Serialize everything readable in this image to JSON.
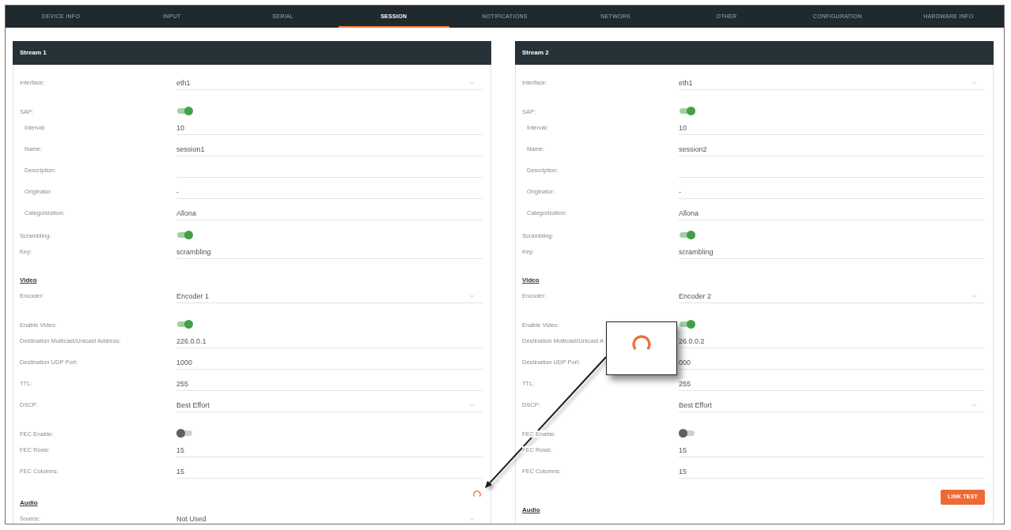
{
  "tabs": [
    {
      "label": "DEVICE INFO",
      "selected": false
    },
    {
      "label": "INPUT",
      "selected": false
    },
    {
      "label": "SERIAL",
      "selected": false
    },
    {
      "label": "SESSION",
      "selected": true
    },
    {
      "label": "NOTIFICATIONS",
      "selected": false
    },
    {
      "label": "NETWORK",
      "selected": false
    },
    {
      "label": "OTHER",
      "selected": false
    },
    {
      "label": "CONFIGURATION",
      "selected": false
    },
    {
      "label": "HARDWARE INFO",
      "selected": false
    }
  ],
  "streams": [
    {
      "title": "Stream 1",
      "fields": [
        {
          "kind": "select",
          "label": "Interface:",
          "value": "eth1"
        },
        {
          "kind": "toggle",
          "label": "SAP:",
          "on": true,
          "children": [
            {
              "kind": "text",
              "label": "Interval:",
              "value": "10"
            },
            {
              "kind": "text",
              "label": "Name:",
              "value": "session1"
            },
            {
              "kind": "text",
              "label": "Description:"
            },
            {
              "kind": "text",
              "label": "Originator:",
              "value": "-"
            },
            {
              "kind": "text",
              "label": "Categorization:",
              "value": "Allona"
            }
          ]
        },
        {
          "kind": "toggle",
          "label": "Scrambling:",
          "on": true
        },
        {
          "kind": "text",
          "label": "Key:",
          "value": "scrambling"
        }
      ],
      "sections": [
        {
          "heading": "Video",
          "fields": [
            {
              "kind": "select",
              "label": "Encoder:",
              "value": "Encoder 1"
            },
            {
              "kind": "toggle",
              "label": "Enable Video:",
              "on": true
            },
            {
              "kind": "text",
              "label": "Destination Multicast/Unicast Address:",
              "value": "226.0.0.1"
            },
            {
              "kind": "text",
              "label": "Destination UDP Port:",
              "value": "1000"
            },
            {
              "kind": "text",
              "label": "TTL:",
              "value": "255"
            },
            {
              "kind": "select",
              "label": "DSCP:",
              "value": "Best Effort"
            },
            {
              "kind": "toggle",
              "label": "FEC Enable:",
              "on": false
            },
            {
              "kind": "text",
              "label": "FEC Rows:",
              "value": "15"
            },
            {
              "kind": "text",
              "label": "FEC Columns:",
              "value": "15"
            }
          ],
          "action": {
            "kind": "spinner"
          }
        },
        {
          "heading": "Audio",
          "fields": [
            {
              "kind": "select",
              "label": "Source:",
              "value": "Not Used"
            }
          ]
        }
      ]
    },
    {
      "title": "Stream 2",
      "fields": [
        {
          "kind": "select",
          "label": "Interface:",
          "value": "eth1"
        },
        {
          "kind": "toggle",
          "label": "SAP:",
          "on": true,
          "children": [
            {
              "kind": "text",
              "label": "Interval:",
              "value": "10"
            },
            {
              "kind": "text",
              "label": "Name:",
              "value": "session2"
            },
            {
              "kind": "text",
              "label": "Description:"
            },
            {
              "kind": "text",
              "label": "Originator:",
              "value": "-"
            },
            {
              "kind": "text",
              "label": "Categorization:",
              "value": "Allona"
            }
          ]
        },
        {
          "kind": "toggle",
          "label": "Scrambling:",
          "on": true
        },
        {
          "kind": "text",
          "label": "Key:",
          "value": "scrambling"
        }
      ],
      "sections": [
        {
          "heading": "Video",
          "fields": [
            {
              "kind": "select",
              "label": "Encoder:",
              "value": "Encoder 2"
            },
            {
              "kind": "toggle",
              "label": "Enable Video:",
              "on": true
            },
            {
              "kind": "text",
              "label": "Destination Multicast/Unicast A",
              "value": "26.0.0.2"
            },
            {
              "kind": "text",
              "label": "Destination UDP Port:",
              "value": "000"
            },
            {
              "kind": "text",
              "label": "TTL:",
              "value": "255"
            },
            {
              "kind": "select",
              "label": "DSCP:",
              "value": "Best Effort"
            },
            {
              "kind": "toggle",
              "label": "FEC Enable:",
              "on": false
            },
            {
              "kind": "text",
              "label": "FEC Rows:",
              "value": "15"
            },
            {
              "kind": "text",
              "label": "FEC Columns:",
              "value": "15"
            }
          ],
          "action": {
            "kind": "button",
            "label": "LINK TEST"
          }
        },
        {
          "heading": "Audio"
        }
      ]
    }
  ],
  "annotation": {
    "kind": "magnified-view"
  }
}
